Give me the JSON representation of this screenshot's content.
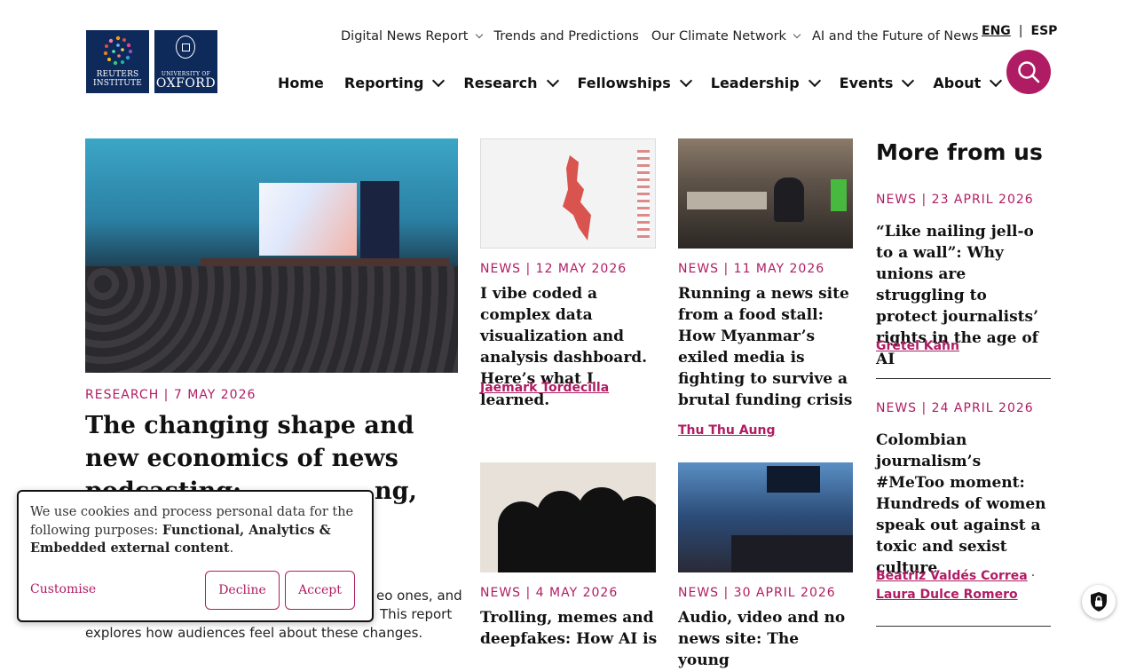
{
  "brand": {
    "reuters_line1": "REUTERS",
    "reuters_line2": "INSTITUTE",
    "oxford_line1": "UNIVERSITY OF",
    "oxford_line2": "OXFORD"
  },
  "top_nav": [
    {
      "label": "Digital News Report",
      "dropdown": true
    },
    {
      "label": "Trends and Predictions",
      "dropdown": false
    },
    {
      "label": "Our Climate Network",
      "dropdown": true
    },
    {
      "label": "AI and the Future of News",
      "dropdown": false
    }
  ],
  "languages": {
    "current": "ENG",
    "separator": "|",
    "other": "ESP"
  },
  "main_nav": [
    "Home",
    "Reporting",
    "Research",
    "Fellowships",
    "Leadership",
    "Events",
    "About"
  ],
  "colors": {
    "accent": "#b01c63",
    "navy": "#0e2a5a"
  },
  "hero": {
    "meta": "RESEARCH | 7 MAY 2026",
    "title": "The changing shape and new economics of news podcasting: ",
    "title_tail": "ng,",
    "excerpt_tail1": "eo ones, and",
    "excerpt_tail2": "This report",
    "excerpt_line3": "explores how audiences feel about these changes."
  },
  "articles": [
    {
      "meta": "NEWS | 12 MAY 2026",
      "title": "I vibe coded a complex data visualization and analysis dashboard. Here’s what I learned.",
      "author": "Jaemark Tordecilla"
    },
    {
      "meta": "NEWS | 11 MAY 2026",
      "title": "Running a news site from a food stall: How Myanmar’s exiled media is fighting to survive a brutal funding crisis",
      "author": "Thu Thu Aung"
    },
    {
      "meta": "NEWS | 4 MAY 2026",
      "title": "Trolling, memes and deepfakes: How AI is"
    },
    {
      "meta": "NEWS | 30 APRIL 2026",
      "title": "Audio, video and no news site: The young"
    }
  ],
  "more": {
    "title": "More from us",
    "items": [
      {
        "meta": "NEWS | 23 APRIL 2026",
        "title": "“Like nailing jell-o to a wall”: Why unions are struggling to protect journalists’ rights in the age of AI",
        "authors": [
          "Gretel Kahn"
        ]
      },
      {
        "meta": "NEWS | 24 APRIL 2026",
        "title": "Colombian journalism’s #MeToo moment: Hundreds of women speak out against a toxic and sexist culture",
        "authors": [
          "Beatriz Valdés Correa",
          "Laura Dulce Romero"
        ]
      }
    ]
  },
  "cookie": {
    "text_prefix": "We use cookies and process personal data for the following purposes: ",
    "purposes": "Functional, Analytics & Embedded external content",
    "text_suffix": ".",
    "customise": "Customise",
    "decline": "Decline",
    "accept": "Accept"
  },
  "icons": [
    "search-icon",
    "chevron-down-icon",
    "privacy-lock-icon"
  ]
}
